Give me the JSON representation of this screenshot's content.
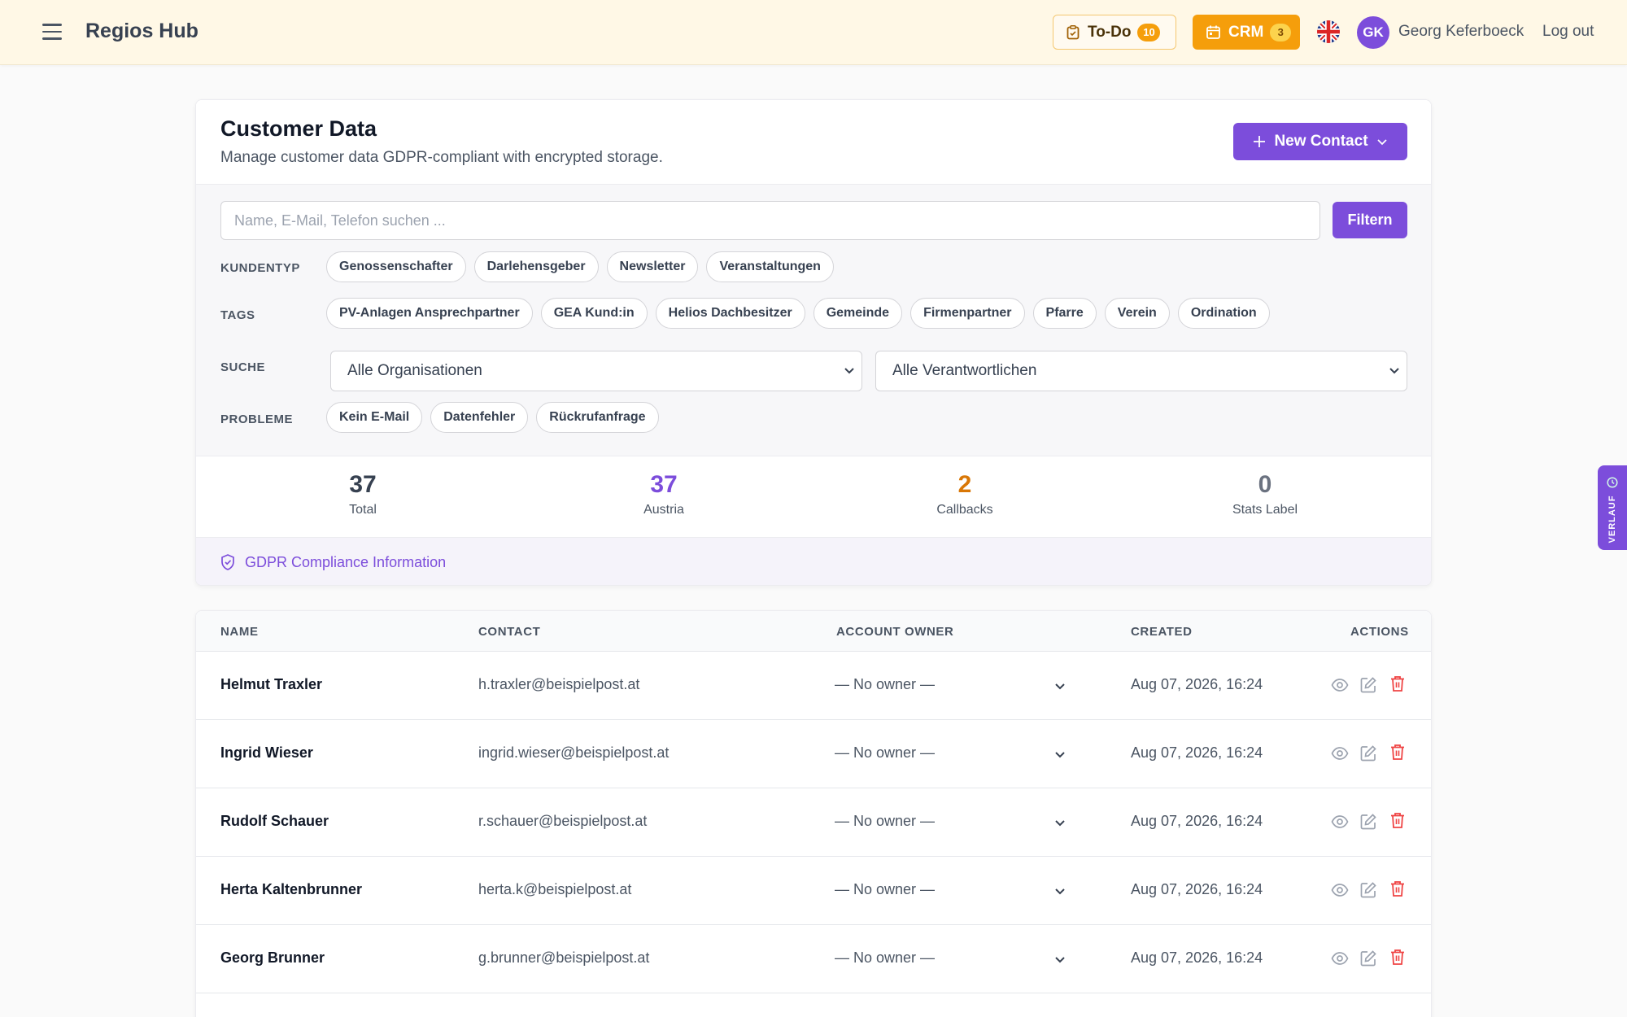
{
  "app": {
    "brand": "Regios Hub"
  },
  "header": {
    "todo_label": "To-Do",
    "todo_count": "10",
    "crm_label": "CRM",
    "crm_count": "3",
    "avatar_initials": "GK",
    "user_name": "Georg Keferboeck",
    "logout_label": "Log out"
  },
  "page": {
    "title": "Customer Data",
    "subtitle": "Manage customer data GDPR-compliant with encrypted storage.",
    "new_contact_label": "New Contact"
  },
  "filters": {
    "search_placeholder": "Name, E-Mail, Telefon suchen ...",
    "filter_button": "Filtern",
    "kundentyp_label": "KUNDENTYP",
    "kundentyp": [
      "Genossenschafter",
      "Darlehensgeber",
      "Newsletter",
      "Veranstaltungen"
    ],
    "tags_label": "TAGS",
    "tags": [
      "PV-Anlagen Ansprechpartner",
      "GEA Kund:in",
      "Helios Dachbesitzer",
      "Gemeinde",
      "Firmenpartner",
      "Pfarre",
      "Verein",
      "Ordination"
    ],
    "suche_label": "SUCHE",
    "org_select": "Alle Organisationen",
    "owner_select": "Alle Verantwortlichen",
    "probleme_label": "PROBLEME",
    "probleme": [
      "Kein E-Mail",
      "Datenfehler",
      "Rückrufanfrage"
    ]
  },
  "stats": [
    {
      "value": "37",
      "label": "Total",
      "color": "#374151"
    },
    {
      "value": "37",
      "label": "Austria",
      "color": "#7c4ddb"
    },
    {
      "value": "2",
      "label": "Callbacks",
      "color": "#d97706"
    },
    {
      "value": "0",
      "label": "Stats Label",
      "color": "#6b7280"
    }
  ],
  "gdpr_link": "GDPR Compliance Information",
  "table": {
    "columns": {
      "name": "NAME",
      "contact": "CONTACT",
      "owner": "ACCOUNT OWNER",
      "created": "CREATED",
      "actions": "ACTIONS"
    },
    "rows": [
      {
        "name": "Helmut Traxler",
        "contact": "h.traxler@beispielpost.at",
        "owner": "— No owner —",
        "created": "Aug 07, 2026, 16:24"
      },
      {
        "name": "Ingrid Wieser",
        "contact": "ingrid.wieser@beispielpost.at",
        "owner": "— No owner —",
        "created": "Aug 07, 2026, 16:24"
      },
      {
        "name": "Rudolf Schauer",
        "contact": "r.schauer@beispielpost.at",
        "owner": "— No owner —",
        "created": "Aug 07, 2026, 16:24"
      },
      {
        "name": "Herta Kaltenbrunner",
        "contact": "herta.k@beispielpost.at",
        "owner": "— No owner —",
        "created": "Aug 07, 2026, 16:24"
      },
      {
        "name": "Georg Brunner",
        "contact": "g.brunner@beispielpost.at",
        "owner": "— No owner —",
        "created": "Aug 07, 2026, 16:24"
      }
    ]
  },
  "side_tab": "VERLAUF",
  "colors": {
    "accent": "#7c4ddb",
    "warning": "#f59e0b",
    "danger": "#ef4444"
  }
}
